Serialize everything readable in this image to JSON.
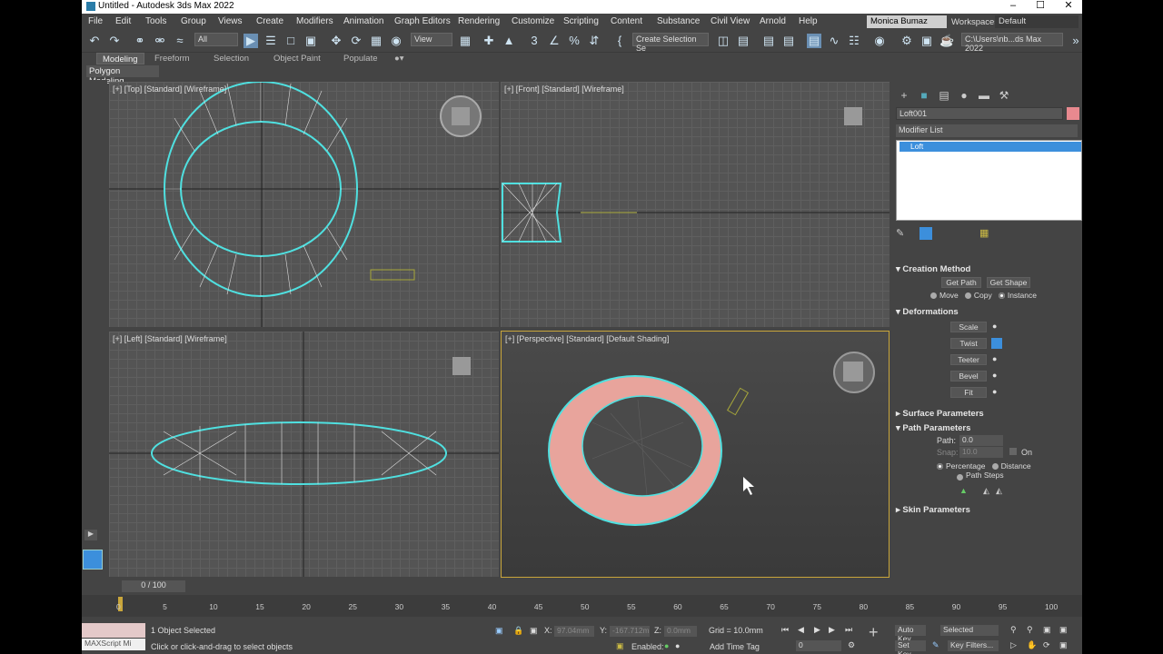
{
  "window": {
    "title": "Untitled - Autodesk 3ds Max 2022"
  },
  "menu": [
    "File",
    "Edit",
    "Tools",
    "Group",
    "Views",
    "Create",
    "Modifiers",
    "Animation",
    "Graph Editors",
    "Rendering",
    "Customize",
    "Scripting",
    "Content",
    "Substance",
    "Civil View",
    "Arnold",
    "Help"
  ],
  "user": {
    "name": "Monica Bumaz",
    "workspaces_label": "Workspaces:",
    "workspace": "Default"
  },
  "toolbar": {
    "filter": "All",
    "refcoord": "View",
    "selset": "Create Selection Se",
    "path": "C:\\Users\\nb...ds Max 2022"
  },
  "ribbon": {
    "tabs": [
      "Modeling",
      "Freeform",
      "Selection",
      "Object Paint",
      "Populate"
    ],
    "sub": "Polygon Modeling"
  },
  "viewports": {
    "top": "[+] [Top] [Standard] [Wireframe]",
    "front": "[+] [Front] [Standard] [Wireframe]",
    "left": "[+] [Left] [Standard] [Wireframe]",
    "persp": "[+] [Perspective] [Standard] [Default Shading]"
  },
  "command_panel": {
    "object_name": "Loft001",
    "modifier_list": "Modifier List",
    "stack_item": "Loft",
    "creation_method": {
      "title": "Creation Method",
      "get_path": "Get Path",
      "get_shape": "Get Shape",
      "move": "Move",
      "copy": "Copy",
      "instance": "Instance"
    },
    "deformations": {
      "title": "Deformations",
      "items": [
        "Scale",
        "Twist",
        "Teeter",
        "Bevel",
        "Fit"
      ]
    },
    "surface": "Surface Parameters",
    "path_params": {
      "title": "Path Parameters",
      "path_label": "Path:",
      "path_value": "0.0",
      "snap_label": "Snap:",
      "snap_value": "10.0",
      "on": "On",
      "percentage": "Percentage",
      "distance": "Distance",
      "path_steps": "Path Steps"
    },
    "skin": "Skin Parameters"
  },
  "timeline": {
    "slider": "0 / 100",
    "ticks": [
      "0",
      "5",
      "10",
      "15",
      "20",
      "25",
      "30",
      "35",
      "40",
      "45",
      "50",
      "55",
      "60",
      "65",
      "70",
      "75",
      "80",
      "85",
      "90",
      "95",
      "100"
    ]
  },
  "status": {
    "maxscript": "MAXScript Mi",
    "selected": "1 Object Selected",
    "prompt": "Click or click-and-drag to select objects",
    "x_label": "X:",
    "x": "97.04mm",
    "y_label": "Y:",
    "y": "-167.712m",
    "z_label": "Z:",
    "z": "0.0mm",
    "grid": "Grid = 10.0mm",
    "enabled": "Enabled:",
    "add_time_tag": "Add Time Tag",
    "frame": "0",
    "auto_key": "Auto Key",
    "set_key": "Set Key",
    "key_mode": "Selected",
    "key_filters": "Key Filters..."
  },
  "colors": {
    "accent": "#3c8fdc",
    "selection": "#4fe0e0",
    "object": "#e8a49c",
    "active_border": "#c9a63b"
  }
}
